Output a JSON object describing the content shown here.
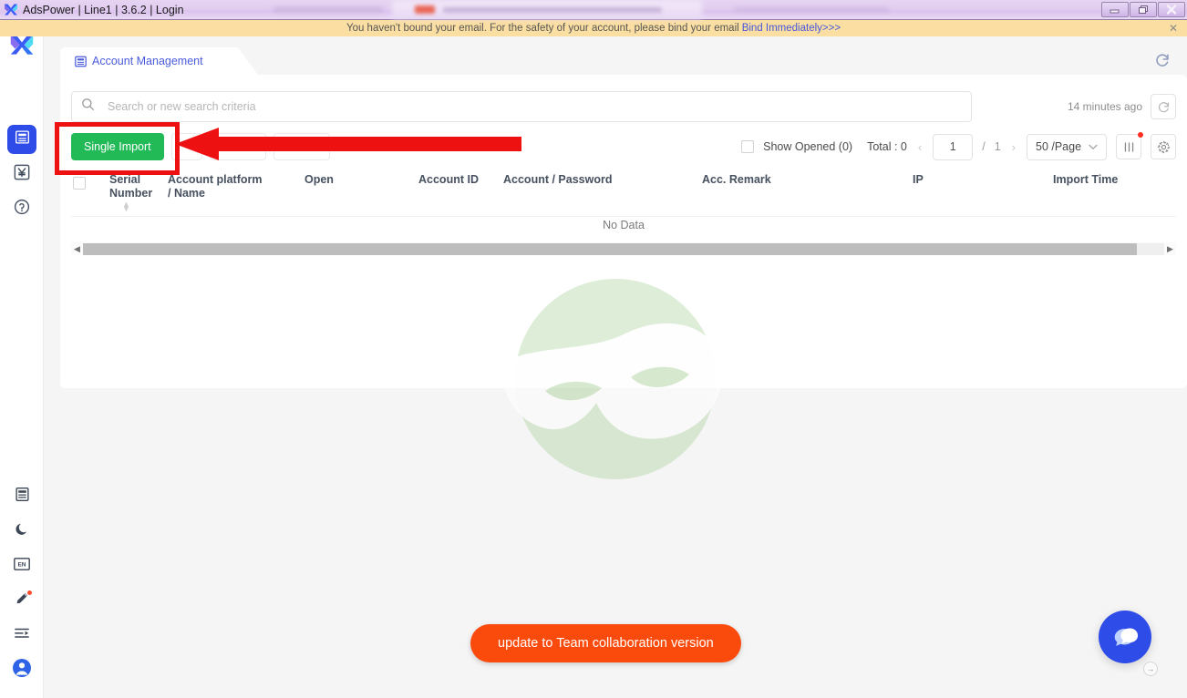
{
  "window": {
    "title": "AdsPower | Line1 | 3.6.2 | Login",
    "app_icon": "adspower-logo-icon",
    "minimize_label": "–",
    "maximize_label": "❐",
    "close_label": "✕"
  },
  "banner": {
    "text": "You haven't bound your email. For the safety of your account, please bind your email",
    "link_text": "Bind Immediately>>>",
    "close_label": "✕"
  },
  "sidebar": {
    "logo_name": "adspower-logo",
    "top_items": [
      {
        "name": "sidebar-item-account-management",
        "icon": "list-panel-icon",
        "active": true
      },
      {
        "name": "sidebar-item-billing",
        "icon": "yen-currency-icon",
        "active": false
      },
      {
        "name": "sidebar-item-help",
        "icon": "question-help-icon",
        "active": false
      }
    ],
    "bottom_items": [
      {
        "name": "sidebar-item-docs",
        "icon": "document-icon",
        "badge": false
      },
      {
        "name": "sidebar-item-theme",
        "icon": "moon-icon",
        "badge": false
      },
      {
        "name": "sidebar-item-language",
        "icon": "language-en-icon",
        "badge": false
      },
      {
        "name": "sidebar-item-feedback",
        "icon": "pencil-icon",
        "badge": true
      },
      {
        "name": "sidebar-item-collapse",
        "icon": "collapse-list-icon",
        "badge": false
      },
      {
        "name": "sidebar-item-profile",
        "icon": "user-avatar-icon",
        "badge": false
      }
    ]
  },
  "tab": {
    "label": "Account Management",
    "icon": "panel-list-icon"
  },
  "toolbar_top": {
    "refresh_icon": "refresh-icon"
  },
  "search": {
    "placeholder": "Search or new search criteria",
    "value": "",
    "icon": "search-icon",
    "last_updated": "14 minutes ago",
    "sync_icon": "sync-refresh-icon"
  },
  "toolbar": {
    "single_import_label": "Single Import",
    "show_opened_label": "Show Opened (0)",
    "total_label": "Total : 0",
    "prev_label": "‹",
    "next_label": "›",
    "page_value": "1",
    "page_separator": "/",
    "page_count": "1",
    "page_size_label": "50 /Page",
    "page_size_caret": "⌄",
    "columns_icon": "columns-settings-icon",
    "settings_icon": "gear-icon",
    "columns_badge_color": "#ff2d20"
  },
  "table": {
    "headers": [
      {
        "label": "Serial Number",
        "name": "th-serial-number",
        "sortable": true
      },
      {
        "label": "Account platform / Name",
        "name": "th-account-platform-name",
        "sortable": false
      },
      {
        "label": "Open",
        "name": "th-open",
        "sortable": false
      },
      {
        "label": "Account ID",
        "name": "th-account-id",
        "sortable": false
      },
      {
        "label": "Account / Password",
        "name": "th-account-password",
        "sortable": false
      },
      {
        "label": "Acc. Remark",
        "name": "th-acc-remark",
        "sortable": false
      },
      {
        "label": "IP",
        "name": "th-ip",
        "sortable": false
      },
      {
        "label": "Import Time",
        "name": "th-import-time",
        "sortable": false
      }
    ],
    "empty_text": "No Data",
    "scroll_left_label": "◀",
    "scroll_right_label": "▶"
  },
  "footer": {
    "update_button_label": "update to Team collaboration version",
    "chat_icon": "chat-bubble-icon",
    "chat_arrow_label": "→"
  },
  "annotations": {
    "highlight_color": "#ee1111",
    "highlight_target": "single-import-button",
    "arrow_direction": "left"
  },
  "colors": {
    "primary_blue": "#2e4ce8",
    "tab_text": "#4a5bdc",
    "green_button": "#21ba56",
    "orange_button": "#fa4b0c",
    "banner_bg": "#fbdfa2",
    "link_blue": "#4455dd"
  }
}
